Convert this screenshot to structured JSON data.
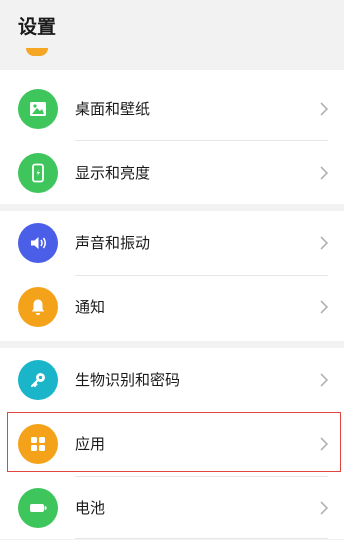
{
  "header": {
    "title": "设置"
  },
  "groups": [
    {
      "items": [
        {
          "label": "桌面和壁纸",
          "icon": "wallpaper-icon",
          "color": "#3ec55c"
        },
        {
          "label": "显示和亮度",
          "icon": "phone-brightness-icon",
          "color": "#3ec55c"
        }
      ]
    },
    {
      "items": [
        {
          "label": "声音和振动",
          "icon": "speaker-icon",
          "color": "#4a5ee8"
        },
        {
          "label": "通知",
          "icon": "bell-icon",
          "color": "#f5a21b"
        }
      ]
    },
    {
      "items": [
        {
          "label": "生物识别和密码",
          "icon": "key-icon",
          "color": "#1ab5c9"
        },
        {
          "label": "应用",
          "icon": "apps-grid-icon",
          "color": "#f5a21b"
        },
        {
          "label": "电池",
          "icon": "battery-icon",
          "color": "#3ec55c"
        }
      ]
    }
  ],
  "highlight_color": "#e0463e"
}
